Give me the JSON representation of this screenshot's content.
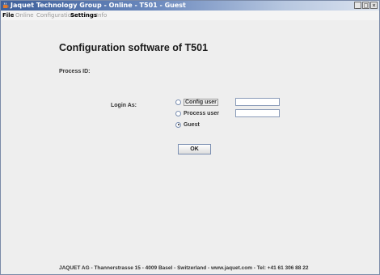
{
  "window": {
    "title": "Jaquet Technology Group - Online - T501 - Guest",
    "minimize_glyph": "_",
    "maximize_glyph": "□",
    "close_glyph": "×"
  },
  "menu": {
    "items": [
      {
        "label": "File",
        "enabled": true
      },
      {
        "label": "Online",
        "enabled": false
      },
      {
        "label": "Configuration",
        "enabled": false
      },
      {
        "label": "Settings",
        "enabled": true
      },
      {
        "label": "Info",
        "enabled": false
      }
    ]
  },
  "main": {
    "title": "Configuration software of T501",
    "process_id_label": "Process ID:",
    "login_label": "Login As:",
    "options": [
      {
        "label": "Config user",
        "selected": false
      },
      {
        "label": "Process user",
        "selected": false
      },
      {
        "label": "Guest",
        "selected": true
      }
    ],
    "config_user_value": "",
    "process_user_value": "",
    "ok_label": "OK"
  },
  "footer": {
    "text": "JAQUET AG - Thannerstrasse 15 - 4009 Basel - Switzerland - www.jaquet.com - Tel: +41 61 306 88 22"
  }
}
